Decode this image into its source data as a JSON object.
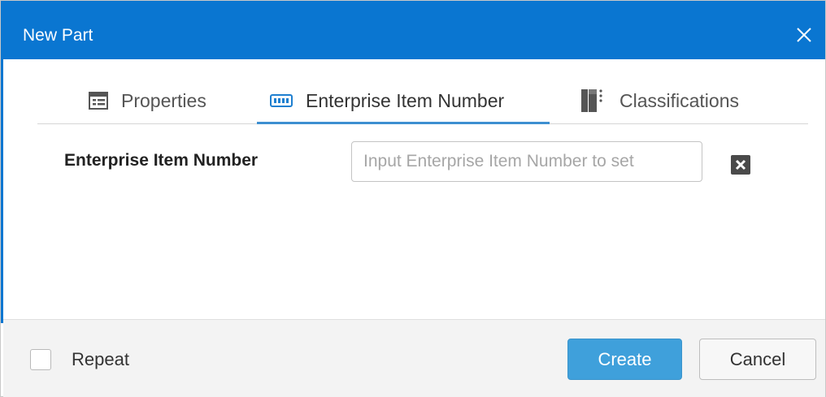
{
  "dialog": {
    "title": "New Part",
    "close_icon": "close-icon"
  },
  "tabs": [
    {
      "label": "Properties",
      "icon": "table-icon",
      "active": false
    },
    {
      "label": "Enterprise Item Number",
      "icon": "barcode-icon",
      "active": true
    },
    {
      "label": "Classifications",
      "icon": "classification-icon",
      "active": false
    }
  ],
  "form": {
    "field_label": "Enterprise Item Number",
    "input_value": "",
    "input_placeholder": "Input Enterprise Item Number to set",
    "clear_icon": "clear-icon"
  },
  "footer": {
    "repeat_label": "Repeat",
    "repeat_checked": false,
    "create_label": "Create",
    "cancel_label": "Cancel"
  },
  "colors": {
    "titlebar": "#0a76d1",
    "tab_underline": "#3d8fd1",
    "primary_button": "#3fa0db"
  }
}
